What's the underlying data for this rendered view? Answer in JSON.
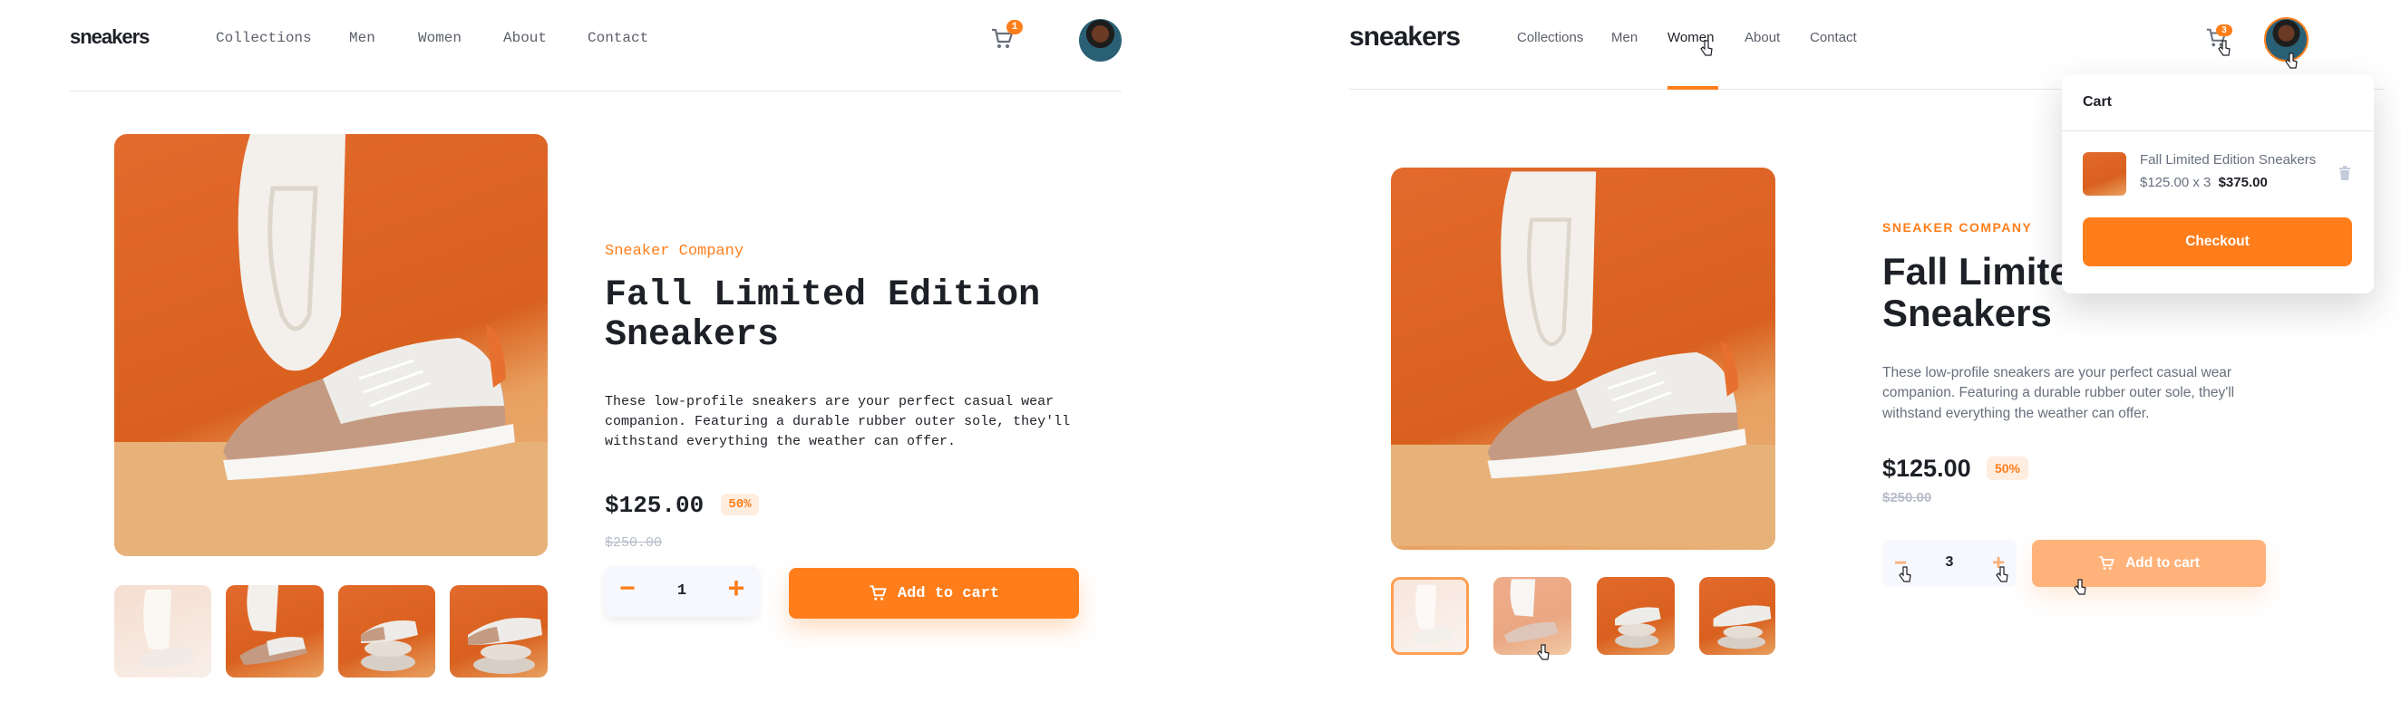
{
  "left": {
    "logo": "sneakers",
    "nav": [
      "Collections",
      "Men",
      "Women",
      "About",
      "Contact"
    ],
    "cart_count": "1",
    "company": "Sneaker Company",
    "title_line1": "Fall Limited Edition",
    "title_line2": "Sneakers",
    "description": "These low-profile sneakers are your perfect casual wear companion. Featuring a durable rubber outer sole, they'll withstand everything the weather can offer.",
    "price": "$125.00",
    "discount": "50%",
    "old_price": "$250.00",
    "qty_minus": "−",
    "qty_value": "1",
    "qty_plus": "+",
    "add_to_cart": "Add to cart"
  },
  "right": {
    "logo": "sneakers",
    "nav": [
      "Collections",
      "Men",
      "Women",
      "About",
      "Contact"
    ],
    "active_nav": "Women",
    "cart_count": "3",
    "company": "SNEAKER COMPANY",
    "title_line1": "Fall Limited Edition",
    "title_line2": "Sneakers",
    "description": "These low-profile sneakers are your perfect casual wear companion. Featuring a durable rubber outer sole, they'll withstand everything the weather can offer.",
    "price": "$125.00",
    "discount": "50%",
    "old_price": "$250.00",
    "qty_minus": "−",
    "qty_value": "3",
    "qty_plus": "+",
    "add_to_cart": "Add to cart",
    "cart_popup": {
      "title": "Cart",
      "item_name": "Fall Limited Edition Sneakers",
      "item_price_line": "$125.00 x 3",
      "item_total": "$375.00",
      "checkout": "Checkout"
    }
  },
  "colors": {
    "accent": "#ff7e1b",
    "accent_pale": "#ffede0",
    "text_dark": "#1d2026",
    "text_grey": "#68707d"
  },
  "icons": [
    "cart-icon",
    "plus-icon",
    "minus-icon",
    "trash-icon",
    "pointer-cursor-icon",
    "avatar"
  ]
}
